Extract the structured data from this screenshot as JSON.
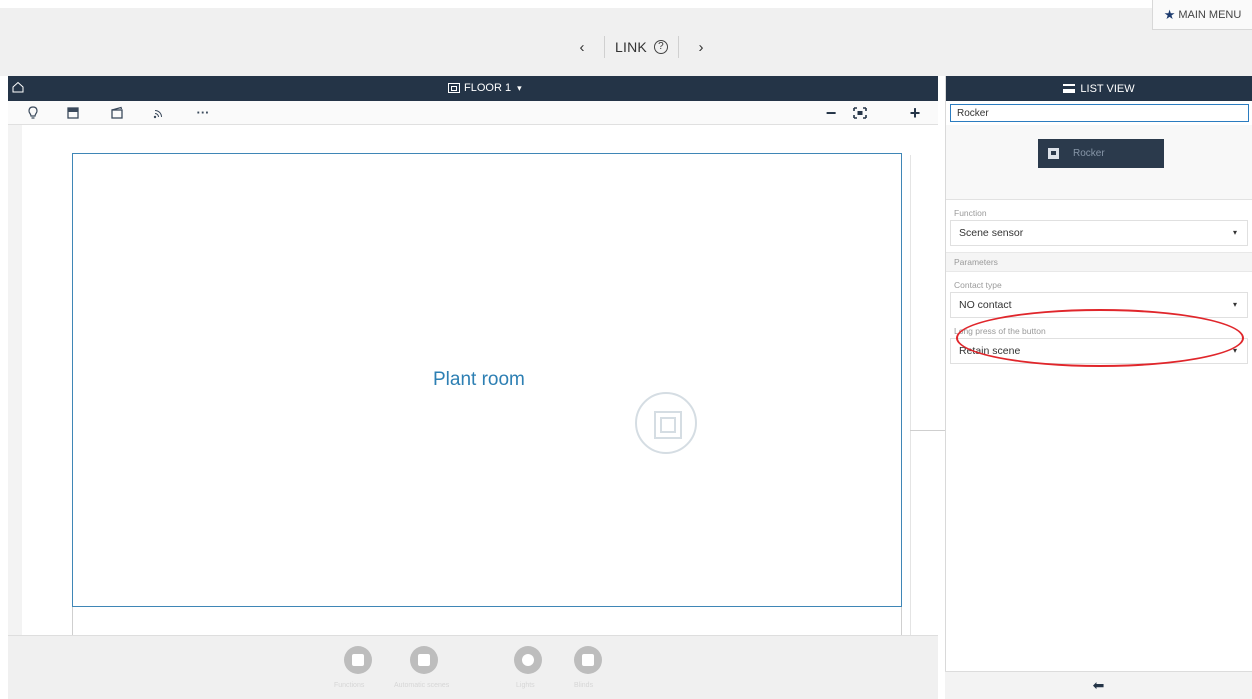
{
  "header": {
    "prev_arrow": "‹",
    "title": "LINK",
    "help_glyph": "?",
    "next_arrow": "›",
    "main_menu_label": "MAIN MENU",
    "main_menu_icon": "star-icon"
  },
  "floor": {
    "title": "FLOOR 1",
    "chevron": "⌄"
  },
  "toolbar": {
    "tools": [
      "lightbulb-icon",
      "blind-icon",
      "scene-icon",
      "wireless-icon",
      "more-icon"
    ],
    "more_glyph": "···",
    "zoom_out": "−",
    "fit": "⬚",
    "zoom_in": "+"
  },
  "plan": {
    "room_name": "Plant room"
  },
  "tray": {
    "items": [
      {
        "label": "Functions"
      },
      {
        "label": "Automatic scenes"
      },
      {
        "label": "Lights"
      },
      {
        "label": "Blinds"
      }
    ]
  },
  "right_panel": {
    "header_title": "LIST VIEW",
    "device_name_value": "Rocker",
    "device_button_label": "Rocker",
    "function_label": "Function",
    "function_value": "Scene sensor",
    "parameters_label": "Parameters",
    "contact_type_label": "Contact type",
    "contact_type_value": "NO contact",
    "long_press_label": "Long press of the button",
    "long_press_value": "Retain scene",
    "back_glyph": "⬅"
  },
  "colors": {
    "header_bg": "#243447",
    "accent_blue": "#2d7fb3",
    "highlight_red": "#e0262b"
  }
}
